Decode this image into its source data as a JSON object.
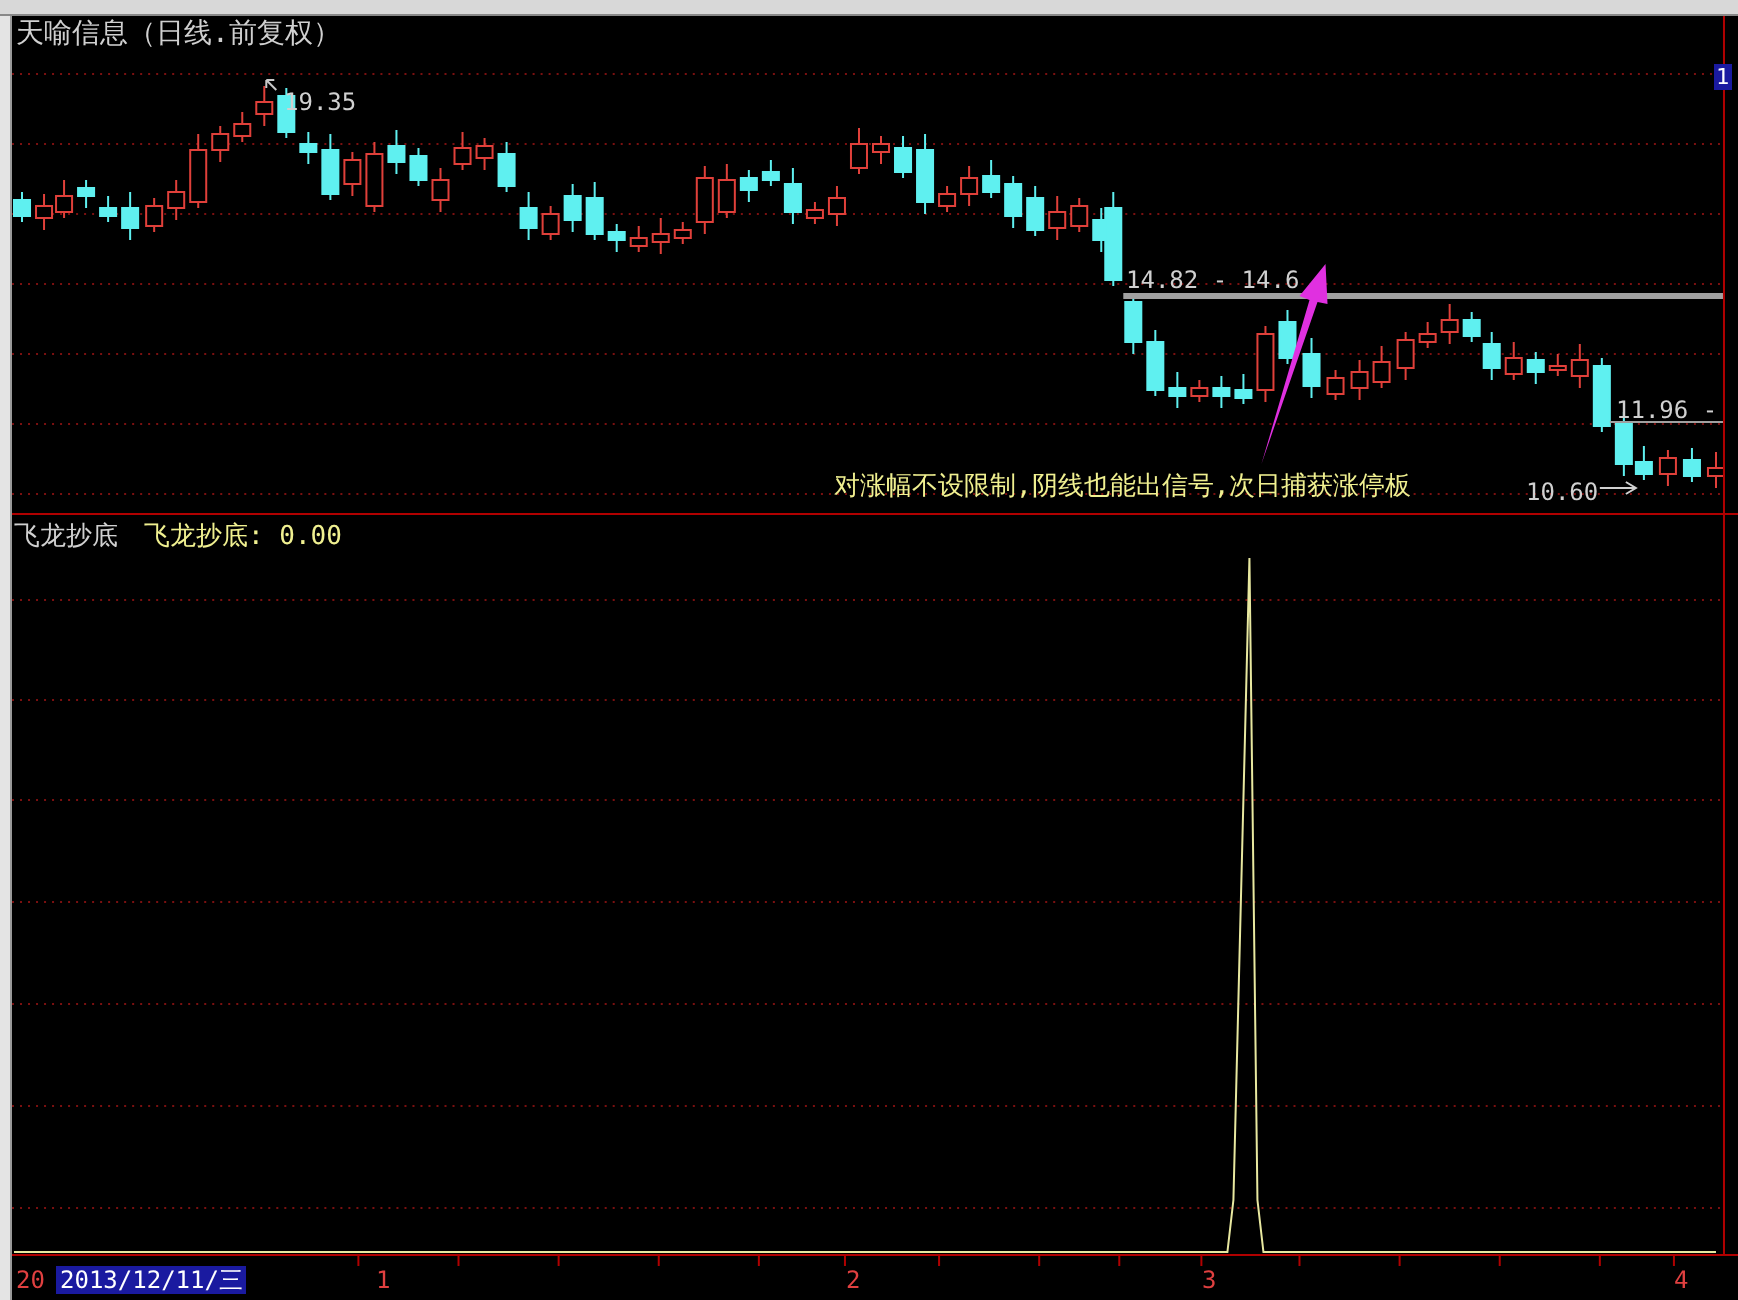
{
  "chart_title": "天喻信息（日线.前复权）",
  "right_axis_label": "1",
  "price_labels": {
    "high": "19.35",
    "range": "14.82 - 14.6",
    "level": "11.96 -",
    "low": "10.60"
  },
  "annotation": "对涨幅不设限制,阴线也能出信号,次日捕获涨停板",
  "indicator": {
    "name": "飞龙抄底",
    "value_label": "飞龙抄底: 0.00"
  },
  "date_axis": {
    "prefix": "20",
    "cursor_date": "2013/12/11/三",
    "ticks": [
      "1",
      "2",
      "3",
      "4"
    ]
  }
}
